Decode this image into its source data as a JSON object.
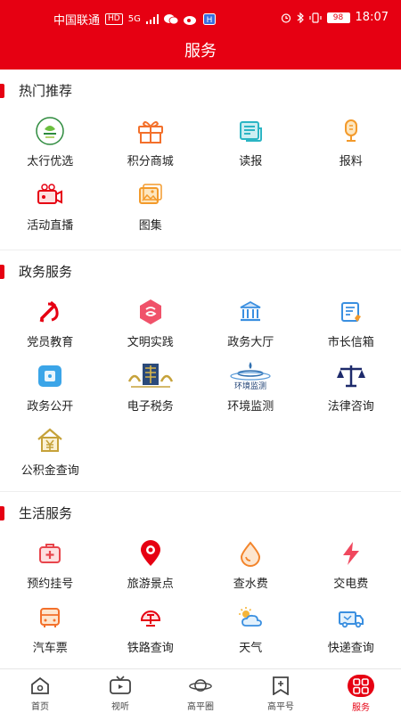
{
  "status_bar": {
    "carrier": "中国联通",
    "hd": "HD",
    "network": "5G",
    "battery": "98",
    "time": "18:07"
  },
  "title": "服务",
  "sections": [
    {
      "title": "热门推荐",
      "items": [
        {
          "label": "太行优选",
          "icon": "taihang-logo-icon"
        },
        {
          "label": "积分商城",
          "icon": "gift-icon"
        },
        {
          "label": "读报",
          "icon": "newspaper-icon"
        },
        {
          "label": "报料",
          "icon": "microphone-icon"
        },
        {
          "label": "活动直播",
          "icon": "video-camera-icon"
        },
        {
          "label": "图集",
          "icon": "gallery-icon"
        }
      ]
    },
    {
      "title": "政务服务",
      "items": [
        {
          "label": "党员教育",
          "icon": "party-emblem-icon"
        },
        {
          "label": "文明实践",
          "icon": "civilization-icon"
        },
        {
          "label": "政务大厅",
          "icon": "government-hall-icon"
        },
        {
          "label": "市长信箱",
          "icon": "mailbox-icon"
        },
        {
          "label": "政务公开",
          "icon": "public-info-icon"
        },
        {
          "label": "电子税务",
          "icon": "tax-logo-icon"
        },
        {
          "label": "环境监测",
          "icon": "environment-logo-icon",
          "logo_text": "环境监测"
        },
        {
          "label": "法律咨询",
          "icon": "scales-icon"
        },
        {
          "label": "公积金查询",
          "icon": "housing-fund-icon"
        }
      ]
    },
    {
      "title": "生活服务",
      "items": [
        {
          "label": "预约挂号",
          "icon": "medical-kit-icon"
        },
        {
          "label": "旅游景点",
          "icon": "location-pin-icon"
        },
        {
          "label": "查水费",
          "icon": "water-drop-icon"
        },
        {
          "label": "交电费",
          "icon": "lightning-icon"
        },
        {
          "label": "汽车票",
          "icon": "bus-icon"
        },
        {
          "label": "铁路查询",
          "icon": "train-icon"
        },
        {
          "label": "天气",
          "icon": "weather-icon"
        },
        {
          "label": "快递查询",
          "icon": "delivery-truck-icon"
        },
        {
          "label": "",
          "icon": "warning-card-icon"
        }
      ]
    }
  ],
  "tab_bar": [
    {
      "label": "首页",
      "icon": "home-icon"
    },
    {
      "label": "视听",
      "icon": "tv-icon"
    },
    {
      "label": "高平圈",
      "icon": "planet-icon"
    },
    {
      "label": "高平号",
      "icon": "bookmark-plus-icon"
    },
    {
      "label": "服务",
      "icon": "grid-icon",
      "active": true
    }
  ],
  "colors": {
    "brand": "#e60012",
    "orange": "#f39a2b",
    "teal": "#2bb5c4",
    "blue": "#3a8fe0"
  }
}
